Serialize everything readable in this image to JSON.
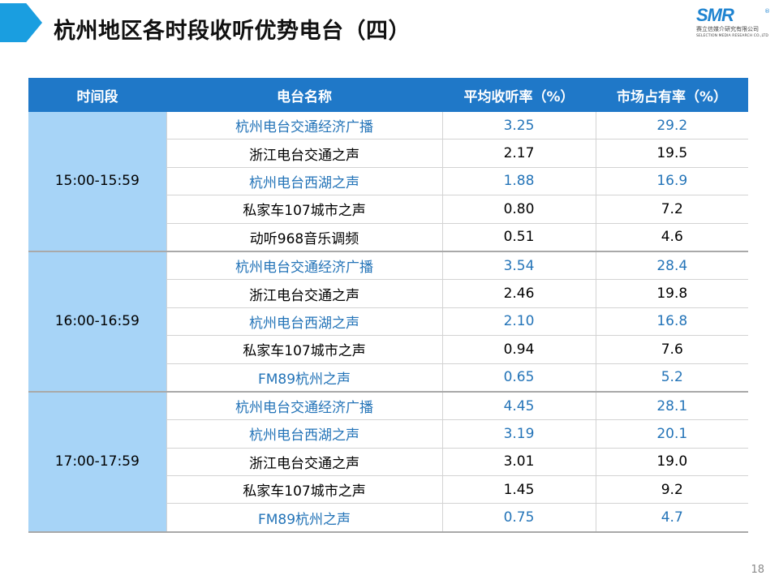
{
  "slide": {
    "title": "杭州地区各时段收听优势电台（四）",
    "page_number": "18"
  },
  "logo": {
    "mark": "SMR",
    "registered": "®",
    "company_cn": "赛立信媒介研究有限公司",
    "company_en": "SELECTION MEDIA RESEARCH CO.,LTD"
  },
  "colors": {
    "accent": "#1a9ee0",
    "header_bg": "#1f78c8",
    "period_bg": "#a7d4f7",
    "highlight_text": "#2474b8"
  },
  "table": {
    "headers": [
      "时间段",
      "电台名称",
      "平均收听率（%）",
      "市场占有率（%）"
    ],
    "groups": [
      {
        "period": "15:00-15:59",
        "rows": [
          {
            "station": "杭州电台交通经济广播",
            "rating": "3.25",
            "share": "29.2",
            "highlight": true
          },
          {
            "station": "浙江电台交通之声",
            "rating": "2.17",
            "share": "19.5",
            "highlight": false
          },
          {
            "station": "杭州电台西湖之声",
            "rating": "1.88",
            "share": "16.9",
            "highlight": true
          },
          {
            "station": "私家车107城市之声",
            "rating": "0.80",
            "share": "7.2",
            "highlight": false
          },
          {
            "station": "动听968音乐调频",
            "rating": "0.51",
            "share": "4.6",
            "highlight": false
          }
        ]
      },
      {
        "period": "16:00-16:59",
        "rows": [
          {
            "station": "杭州电台交通经济广播",
            "rating": "3.54",
            "share": "28.4",
            "highlight": true
          },
          {
            "station": "浙江电台交通之声",
            "rating": "2.46",
            "share": "19.8",
            "highlight": false
          },
          {
            "station": "杭州电台西湖之声",
            "rating": "2.10",
            "share": "16.8",
            "highlight": true
          },
          {
            "station": "私家车107城市之声",
            "rating": "0.94",
            "share": "7.6",
            "highlight": false
          },
          {
            "station": "FM89杭州之声",
            "rating": "0.65",
            "share": "5.2",
            "highlight": true
          }
        ]
      },
      {
        "period": "17:00-17:59",
        "rows": [
          {
            "station": "杭州电台交通经济广播",
            "rating": "4.45",
            "share": "28.1",
            "highlight": true
          },
          {
            "station": "杭州电台西湖之声",
            "rating": "3.19",
            "share": "20.1",
            "highlight": true
          },
          {
            "station": "浙江电台交通之声",
            "rating": "3.01",
            "share": "19.0",
            "highlight": false
          },
          {
            "station": "私家车107城市之声",
            "rating": "1.45",
            "share": "9.2",
            "highlight": false
          },
          {
            "station": "FM89杭州之声",
            "rating": "0.75",
            "share": "4.7",
            "highlight": true
          }
        ]
      }
    ]
  }
}
